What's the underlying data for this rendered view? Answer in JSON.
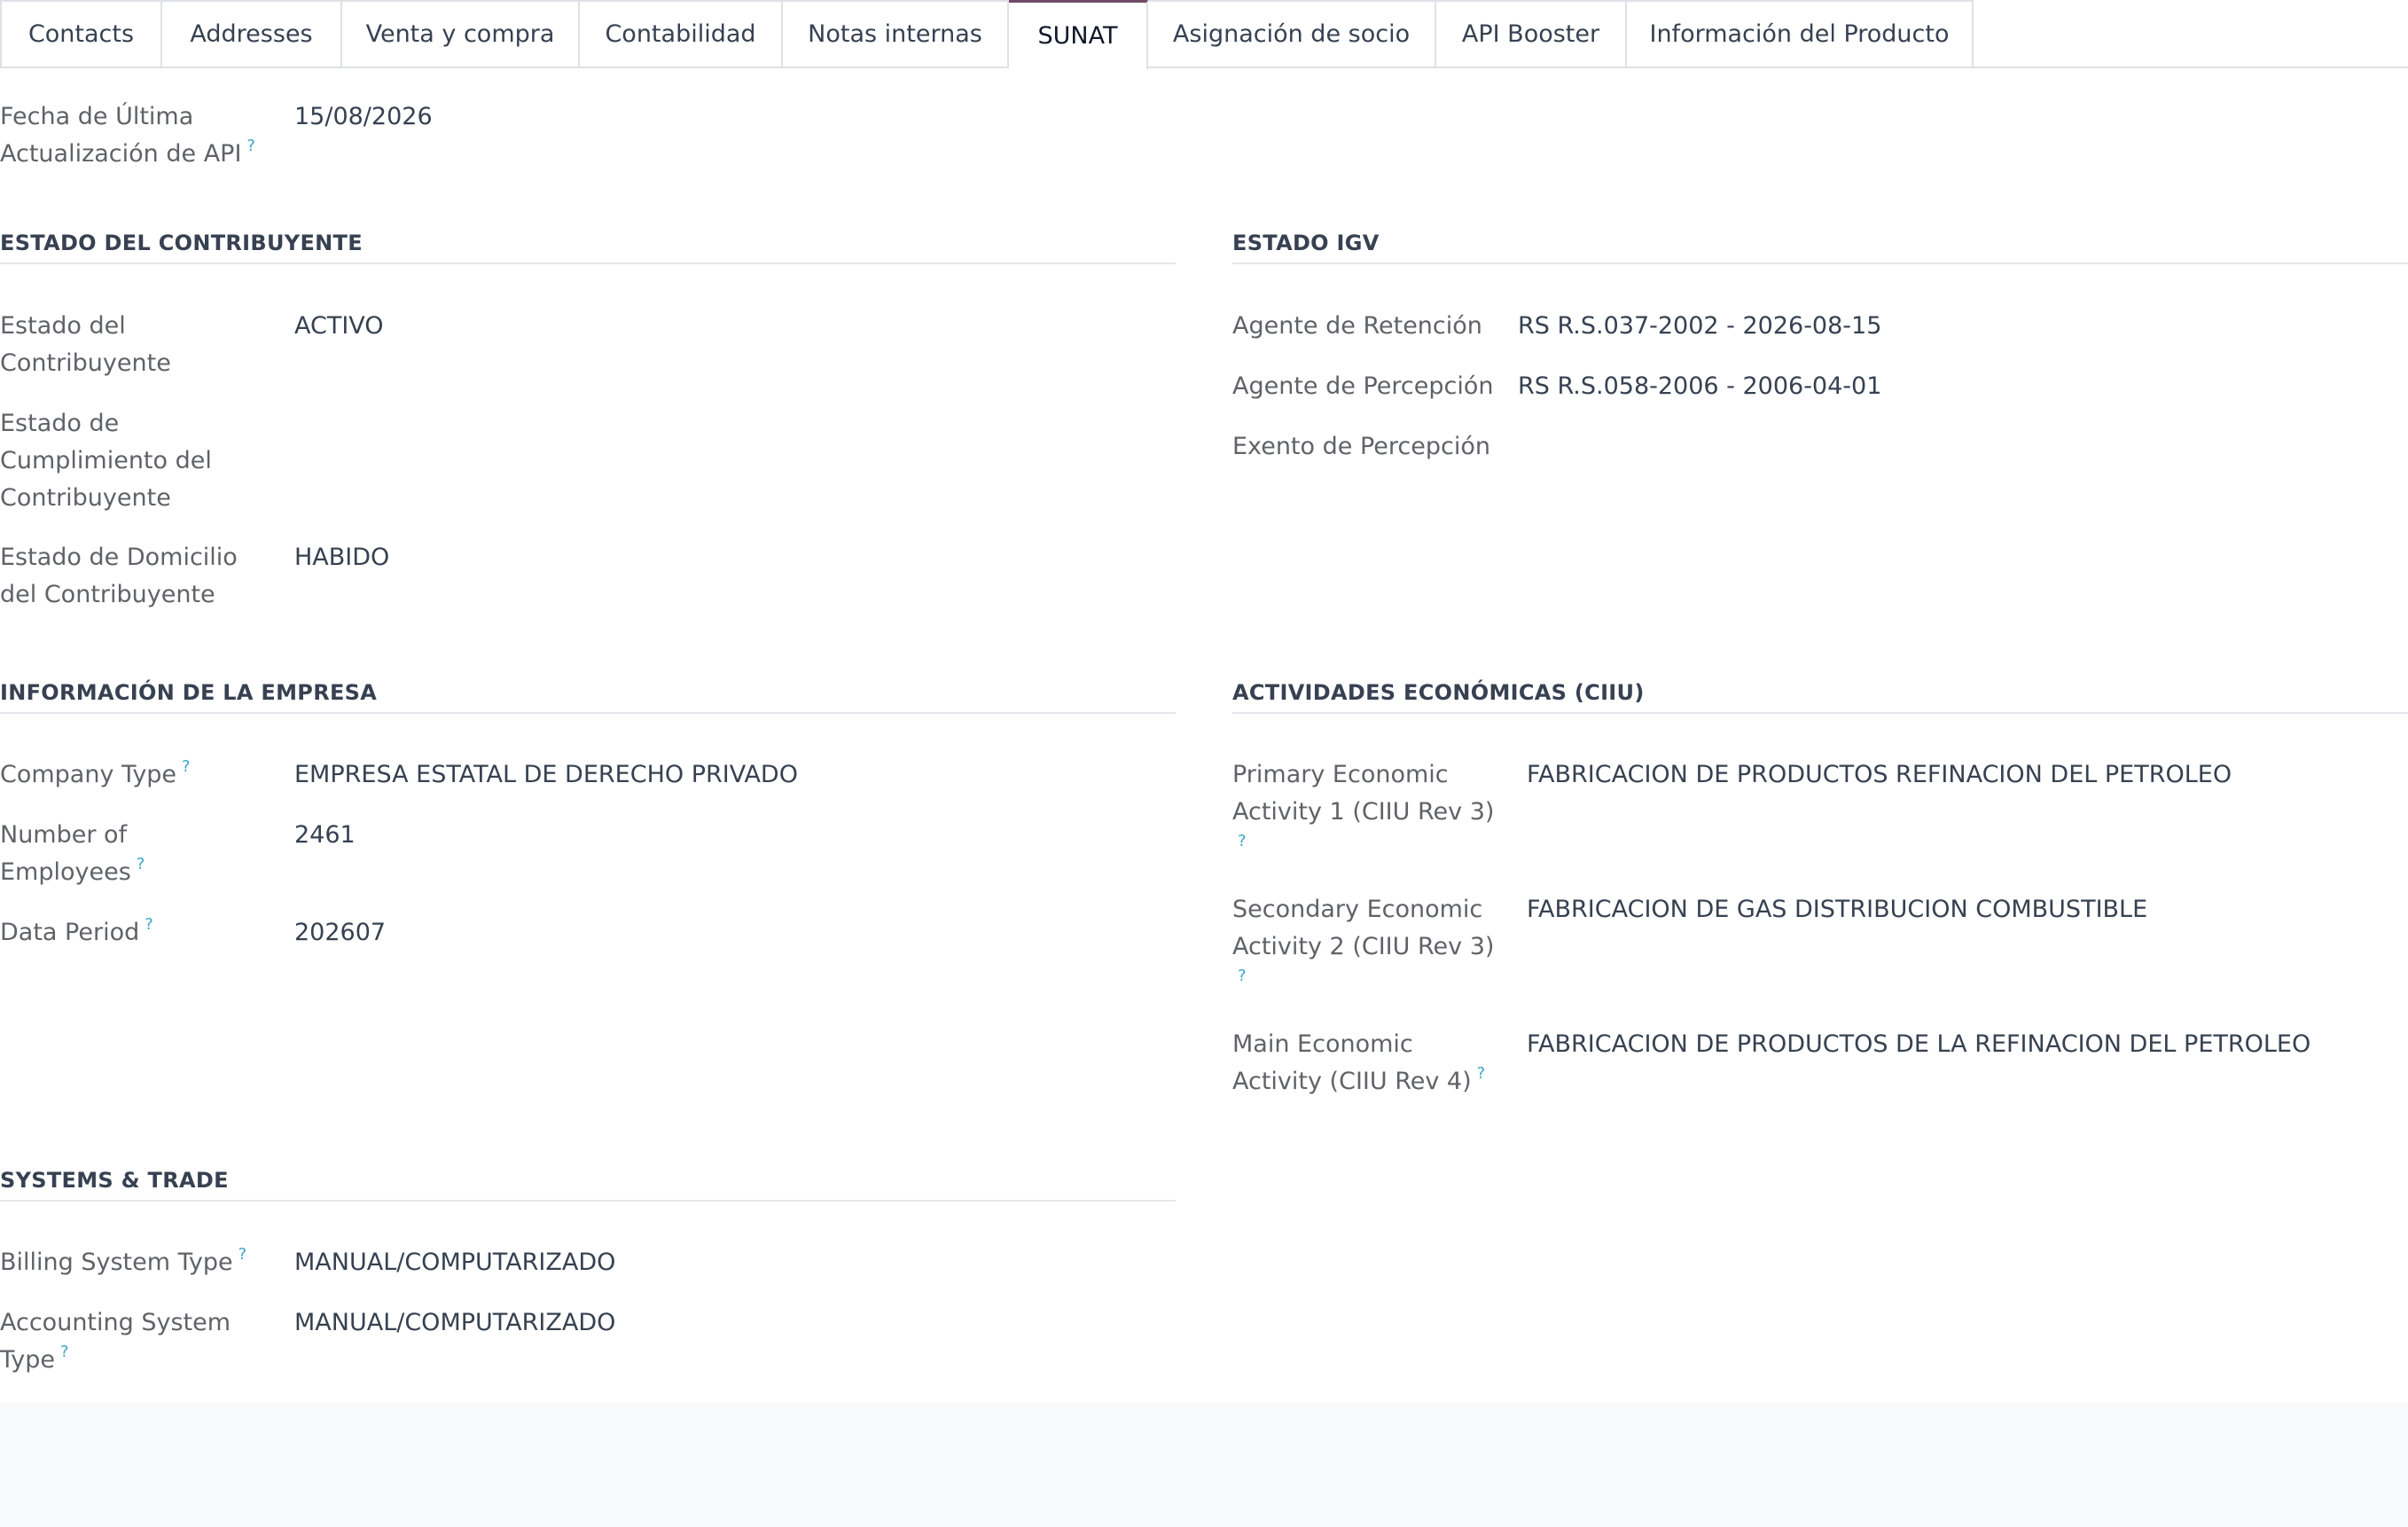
{
  "tabs": [
    {
      "label": "Contacts"
    },
    {
      "label": "Addresses"
    },
    {
      "label": "Venta y compra"
    },
    {
      "label": "Contabilidad"
    },
    {
      "label": "Notas internas"
    },
    {
      "label": "SUNAT",
      "active": true
    },
    {
      "label": "Asignación de socio"
    },
    {
      "label": "API Booster"
    },
    {
      "label": "Información del Producto"
    }
  ],
  "api_update": {
    "label": "Fecha de Última Actualización de API",
    "help": "?",
    "value": "15/08/2026"
  },
  "taxpayer_status": {
    "title": "ESTADO DEL CONTRIBUYENTE",
    "fields": [
      {
        "label": "Estado del Contribuyente",
        "value": "ACTIVO"
      },
      {
        "label": "Estado de Cumplimiento del Contribuyente",
        "value": ""
      },
      {
        "label": "Estado de Domicilio del Contribuyente",
        "value": "HABIDO"
      }
    ]
  },
  "igv_status": {
    "title": "ESTADO IGV",
    "fields": [
      {
        "label": "Agente de Retención",
        "value": "RS R.S.037-2002 - 2026-08-15"
      },
      {
        "label": "Agente de Percepción",
        "value": "RS R.S.058-2006 - 2006-04-01"
      },
      {
        "label": "Exento de Percepción",
        "value": ""
      }
    ]
  },
  "company_info": {
    "title": "INFORMACIÓN DE LA EMPRESA",
    "fields": [
      {
        "label": "Company Type",
        "help": "?",
        "value": "EMPRESA ESTATAL DE DERECHO PRIVADO"
      },
      {
        "label": "Number of Employees",
        "help": "?",
        "value": "2461"
      },
      {
        "label": "Data Period",
        "help": "?",
        "value": "202607"
      }
    ]
  },
  "economic_activities": {
    "title": "ACTIVIDADES ECONÓMICAS (CIIU)",
    "fields": [
      {
        "label": "Primary Economic Activity 1 (CIIU Rev 3)",
        "help": "?",
        "value": "FABRICACION DE PRODUCTOS REFINACION DEL PETROLEO"
      },
      {
        "label": "Secondary Economic Activity 2 (CIIU Rev 3)",
        "help": "?",
        "value": "FABRICACION DE GAS DISTRIBUCION COMBUSTIBLE"
      },
      {
        "label": "Main Economic Activity (CIIU Rev 4)",
        "help": "?",
        "value": "FABRICACION DE PRODUCTOS DE LA REFINACION DEL PETROLEO"
      }
    ]
  },
  "systems_trade": {
    "title": "SYSTEMS & TRADE",
    "fields": [
      {
        "label": "Billing System Type",
        "help": "?",
        "value": "MANUAL/COMPUTARIZADO"
      },
      {
        "label": "Accounting System Type",
        "help": "?",
        "value": "MANUAL/COMPUTARIZADO"
      }
    ]
  }
}
